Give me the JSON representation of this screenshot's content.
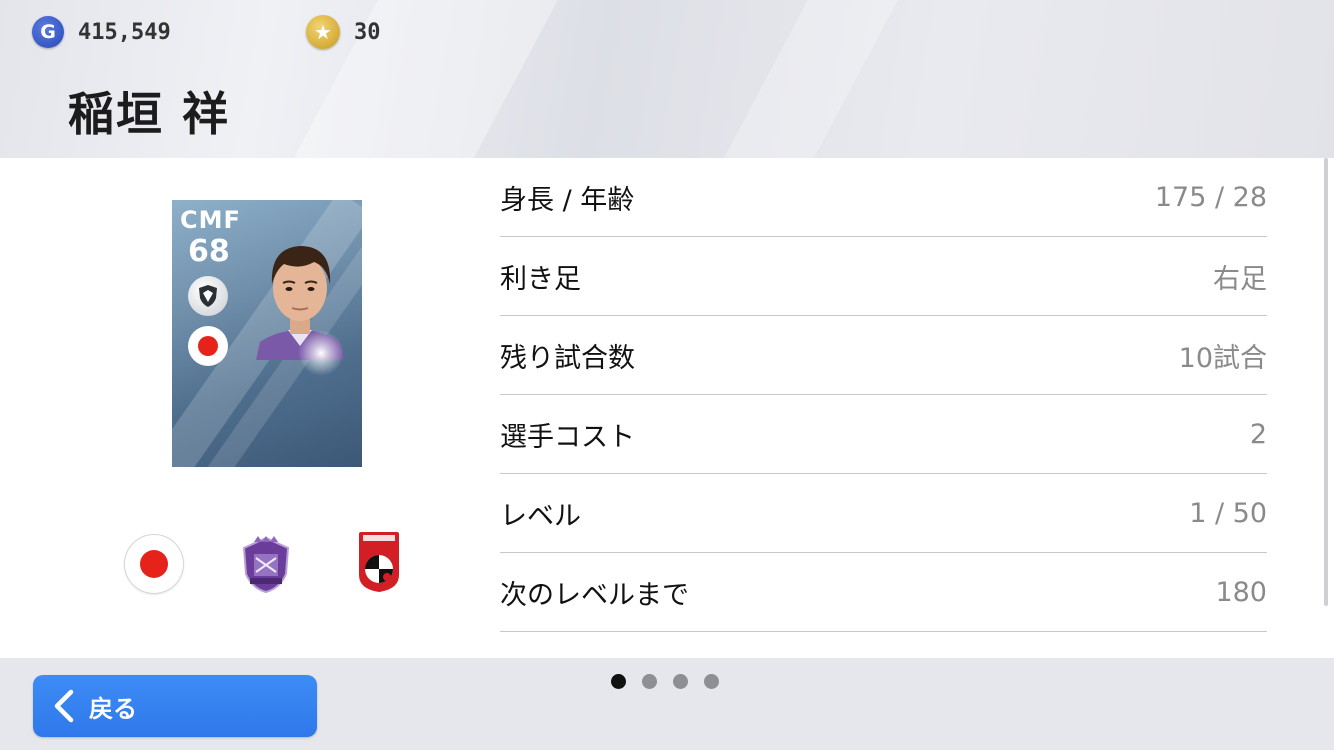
{
  "currency": {
    "gp_icon_letter": "G",
    "gp_value": "415,549",
    "coin_icon": "★",
    "coin_value": "30"
  },
  "player": {
    "name": "稲垣 祥",
    "card": {
      "position": "CMF",
      "rating": "68"
    }
  },
  "stats": [
    {
      "label": "身長 / 年齢",
      "value": "175 / 28"
    },
    {
      "label": "利き足",
      "value": "右足"
    },
    {
      "label": "残り試合数",
      "value": "10試合"
    },
    {
      "label": "選手コスト",
      "value": "2"
    },
    {
      "label": "レベル",
      "value": "1 / 50"
    },
    {
      "label": "次のレベルまで",
      "value": "180"
    }
  ],
  "pagination": {
    "pages": 4,
    "active": 1
  },
  "footer": {
    "back_label": "戻る"
  },
  "colors": {
    "accent_blue": "#3385f2",
    "flag_red": "#e5231b",
    "club_purple": "#6a3d9a",
    "league_red": "#d21f26"
  }
}
